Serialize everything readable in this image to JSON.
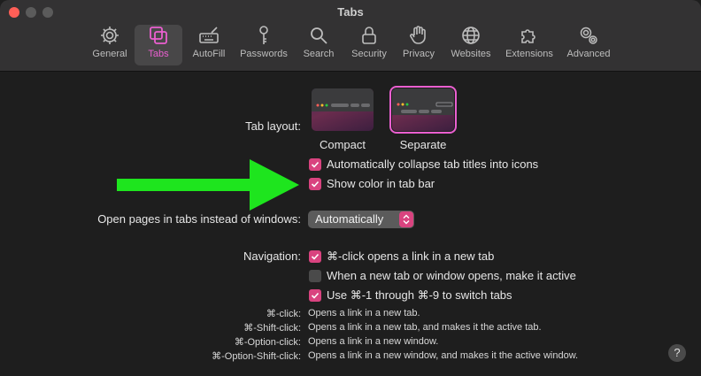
{
  "window": {
    "title": "Tabs"
  },
  "toolbar": {
    "tabs": [
      {
        "label": "General",
        "icon": "gear-icon"
      },
      {
        "label": "Tabs",
        "icon": "tabs-icon",
        "active": true
      },
      {
        "label": "AutoFill",
        "icon": "keyboard-pen-icon"
      },
      {
        "label": "Passwords",
        "icon": "key-icon"
      },
      {
        "label": "Search",
        "icon": "magnifier-icon"
      },
      {
        "label": "Security",
        "icon": "lock-icon"
      },
      {
        "label": "Privacy",
        "icon": "hand-icon"
      },
      {
        "label": "Websites",
        "icon": "globe-icon"
      },
      {
        "label": "Extensions",
        "icon": "puzzle-icon"
      },
      {
        "label": "Advanced",
        "icon": "gears-icon"
      }
    ]
  },
  "settings": {
    "tab_layout_label": "Tab layout:",
    "layout_options": [
      {
        "label": "Compact",
        "selected": false
      },
      {
        "label": "Separate",
        "selected": true
      }
    ],
    "auto_collapse": {
      "label": "Automatically collapse tab titles into icons",
      "checked": true
    },
    "show_color": {
      "label": "Show color in tab bar",
      "checked": true
    },
    "open_pages_label": "Open pages in tabs instead of windows:",
    "open_pages_value": "Automatically",
    "navigation_label": "Navigation:",
    "nav_options": [
      {
        "label": "⌘-click opens a link in a new tab",
        "checked": true
      },
      {
        "label": "When a new tab or window opens, make it active",
        "checked": false
      },
      {
        "label": "Use ⌘-1 through ⌘-9 to switch tabs",
        "checked": true
      }
    ],
    "shortcuts": [
      {
        "key": "⌘-click:",
        "desc": "Opens a link in a new tab."
      },
      {
        "key": "⌘-Shift-click:",
        "desc": "Opens a link in a new tab, and makes it the active tab."
      },
      {
        "key": "⌘-Option-click:",
        "desc": "Opens a link in a new window."
      },
      {
        "key": "⌘-Option-Shift-click:",
        "desc": "Opens a link in a new window, and makes it the active window."
      }
    ],
    "help_label": "?"
  },
  "colors": {
    "accent": "#ea5fd0",
    "checkbox": "#d9437f",
    "annotation_arrow": "#1ee51e"
  }
}
